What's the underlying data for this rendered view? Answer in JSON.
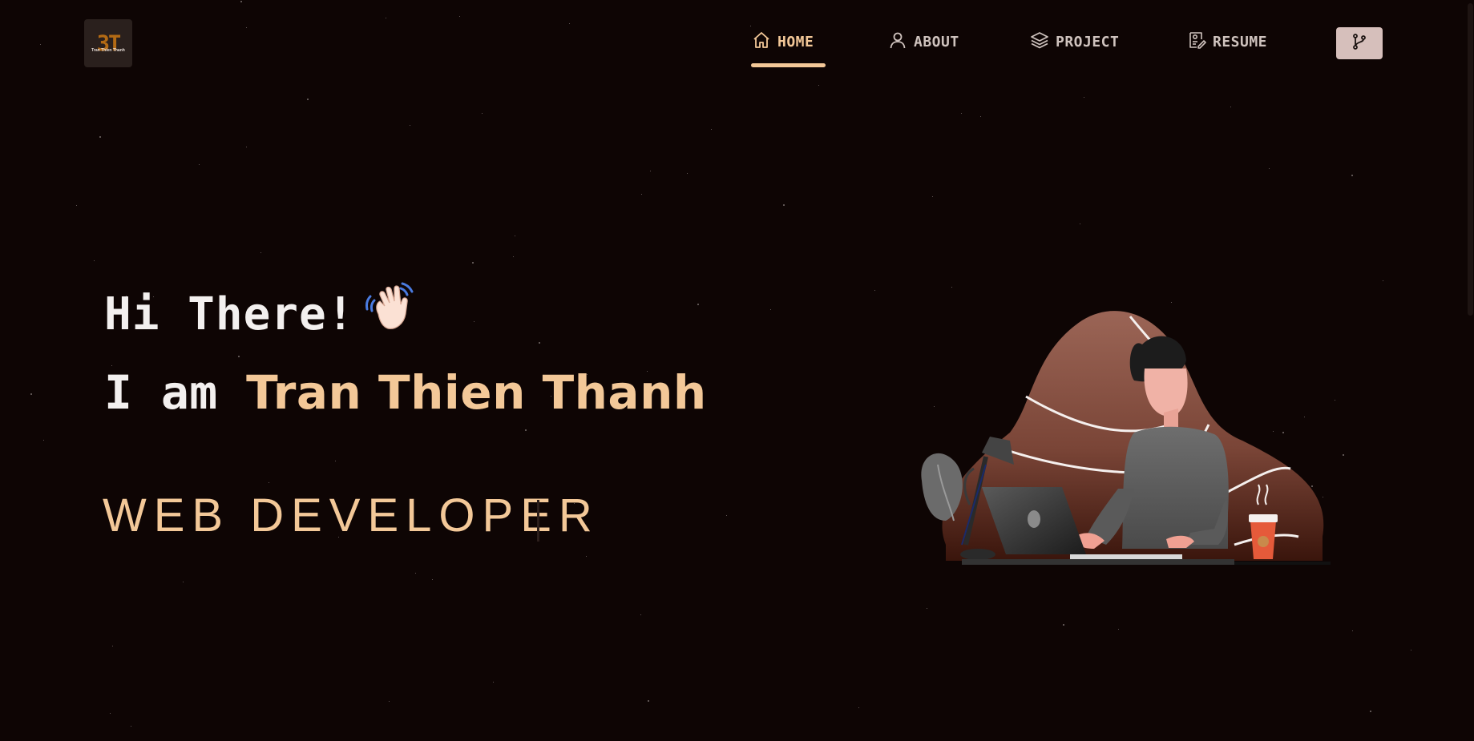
{
  "logo": {
    "mark": "3T",
    "subtitle": "Tran Thien Thanh"
  },
  "nav": {
    "items": [
      {
        "label": "HOME",
        "icon": "home-icon",
        "active": true
      },
      {
        "label": "ABOUT",
        "icon": "user-icon",
        "active": false
      },
      {
        "label": "PROJECT",
        "icon": "layers-icon",
        "active": false
      },
      {
        "label": "RESUME",
        "icon": "resume-icon",
        "active": false
      }
    ],
    "fork_icon": "git-fork-icon"
  },
  "hero": {
    "greeting": "Hi There!",
    "greeting_icon": "waving-hand-icon",
    "name_prefix": "I am ",
    "name": "Tran Thien Thanh",
    "role": "WEB DEVELOPER"
  },
  "colors": {
    "background": "#0e0504",
    "accent": "#f3c898",
    "text": "#f3f0ef",
    "nav_text": "#cfc3be",
    "fork_button": "#d6bfbb",
    "blob": "#8c5a4c"
  }
}
